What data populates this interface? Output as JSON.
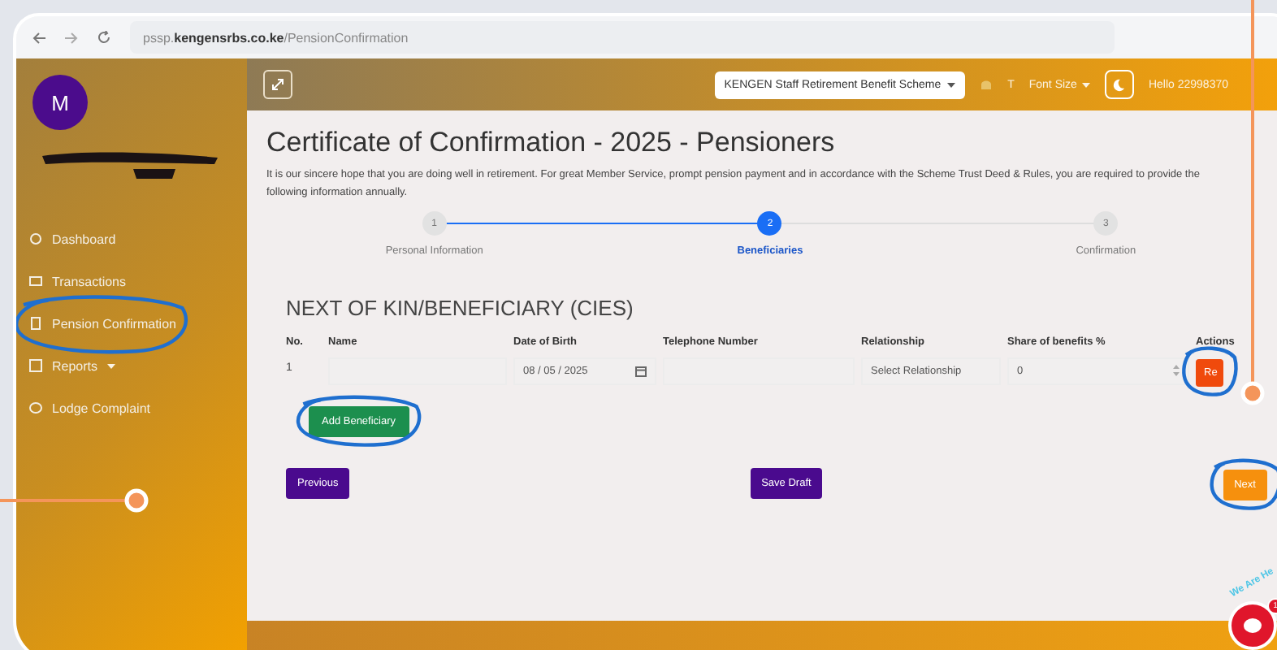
{
  "browser": {
    "url": "pssp.**kengensrbs.co.ke**/PensionConfirmation"
  },
  "sidebar": {
    "avatar": "M",
    "items": [
      {
        "label": "Dashboard",
        "kind": "dashboard",
        "circled": false,
        "has_menu": false
      },
      {
        "label": "Transactions",
        "kind": "card",
        "circled": false,
        "has_menu": false
      },
      {
        "label": "Pension Confirmation",
        "kind": "doc",
        "circled": true,
        "has_menu": false
      },
      {
        "label": "Reports",
        "kind": "report",
        "circled": false,
        "has_menu": true
      },
      {
        "label": "Lodge Complaint",
        "kind": "chat",
        "circled": false,
        "has_menu": false
      }
    ]
  },
  "topbar": {
    "scheme": "KENGEN Staff Retirement Benefit Scheme",
    "font_icon": "T",
    "font_size": "Font Size",
    "greeting": "Hello 22998370"
  },
  "title": "Certificate of Confirmation - 2025 - Pensioners",
  "intro": "It is our sincere hope that you are doing well in retirement. For great Member Service, prompt pension payment and in accordance with the Scheme Trust Deed & Rules, you are required to provide the following information annually.",
  "steps": [
    {
      "number": "1",
      "label": "Personal Information",
      "selected": false
    },
    {
      "number": "2",
      "label": "Beneficiaries",
      "selected": true
    },
    {
      "number": "3",
      "label": "Confirmation",
      "selected": false
    }
  ],
  "section_title": "NEXT OF KIN/BENEFICIARY (CIES)",
  "table": {
    "columns": [
      "No.",
      "Name",
      "Date of Birth",
      "Telephone Number",
      "Relationship",
      "Share of benefits %",
      "Actions"
    ],
    "rows": [
      {
        "no": "1",
        "name": "",
        "dob": "08 / 05 / 2025",
        "phone": "",
        "relationship": "Select Relationship",
        "share": "0",
        "action": "Re"
      }
    ]
  },
  "add_button": "Add Beneficiary",
  "nav": {
    "previous": "Previous",
    "save": "Save Draft",
    "next": "Next"
  },
  "chat": {
    "banner": "We Are He",
    "badge": "1"
  }
}
